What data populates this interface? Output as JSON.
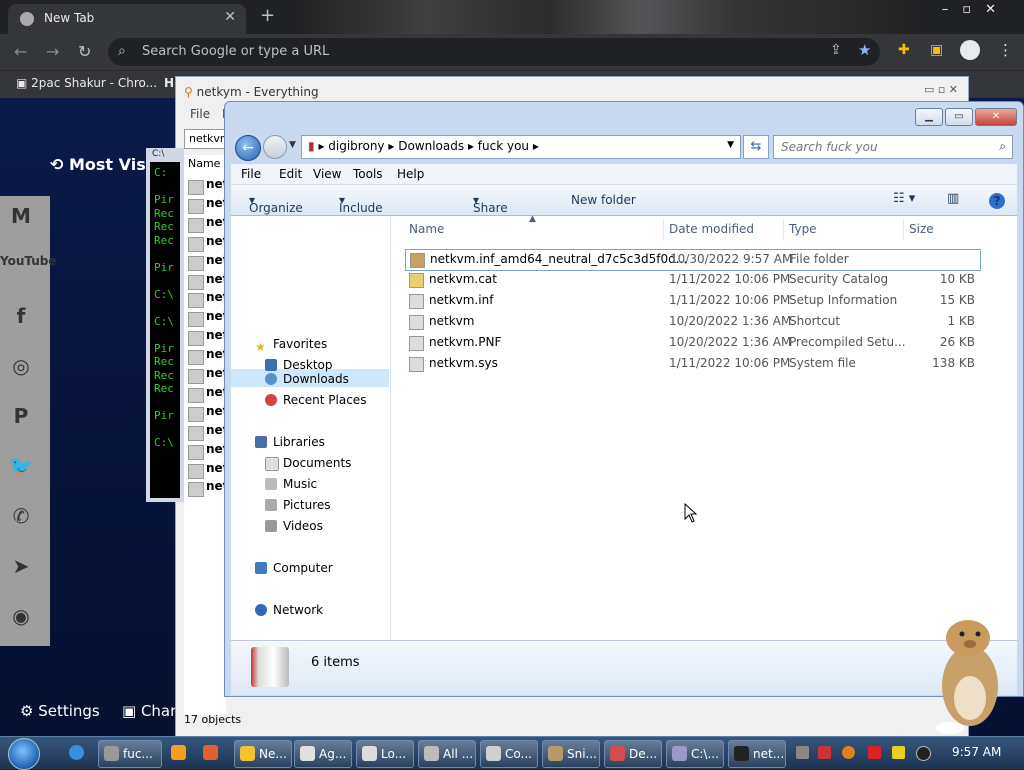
{
  "chrome": {
    "tab_title": "New Tab",
    "tab_close": "✕",
    "new_tab": "+",
    "omnibox_placeholder": "Search Google or type a URL",
    "bookmark_label": "2pac Shakur - Chro...",
    "bookmark_h": "H",
    "most_visited": "Most Visit",
    "settings": "Settings",
    "customize_chrome": "Char"
  },
  "social_icons": [
    "gmail-icon",
    "youtube-icon",
    "facebook-icon",
    "instagram-icon",
    "pinterest-icon",
    "twitter-icon",
    "whatsapp-icon",
    "telegram-icon",
    "reddit-icon"
  ],
  "social_glyphs": [
    "M",
    "YouTube",
    "f",
    "◎",
    "P",
    "🐦",
    "✆",
    "➤",
    "◉"
  ],
  "everything": {
    "title": "netkym - Everything",
    "menu_file": "File",
    "menu_e": "E",
    "search_value": "netkvm",
    "col_name": "Name",
    "items": [
      "net",
      "net",
      "net",
      "net",
      "net",
      "net",
      "net",
      "net",
      "net",
      "net",
      "net",
      "net",
      "net",
      "net",
      "net",
      "net",
      "net"
    ],
    "status": "17 objects"
  },
  "cmd": {
    "lines": [
      "C:",
      "",
      "Pir",
      "Rec",
      "Rec",
      "Rec",
      "",
      "Pir",
      "",
      "C:\\",
      "",
      "C:\\",
      "",
      "Pir",
      "Rec",
      "Rec",
      "Rec",
      "",
      "Pir",
      "",
      "C:\\"
    ]
  },
  "explorer": {
    "breadcrumb": [
      "digibrony",
      "Downloads",
      "fuck you"
    ],
    "search_placeholder": "Search fuck you",
    "menus": [
      "File",
      "Edit",
      "View",
      "Tools",
      "Help"
    ],
    "commands": [
      "Organize",
      "Include in library",
      "Share with",
      "New folder"
    ],
    "nav": {
      "favorites": "Favorites",
      "desktop": "Desktop",
      "downloads": "Downloads",
      "recent": "Recent Places",
      "libraries": "Libraries",
      "documents": "Documents",
      "music": "Music",
      "pictures": "Pictures",
      "videos": "Videos",
      "computer": "Computer",
      "network": "Network"
    },
    "columns": {
      "name": "Name",
      "date": "Date modified",
      "type": "Type",
      "size": "Size"
    },
    "files": [
      {
        "name": "netkvm.inf_amd64_neutral_d7c5c3d5f0d...",
        "date": "10/30/2022 9:57 AM",
        "type": "File folder",
        "size": ""
      },
      {
        "name": "netkvm.cat",
        "date": "1/11/2022 10:06 PM",
        "type": "Security Catalog",
        "size": "10 KB"
      },
      {
        "name": "netkvm.inf",
        "date": "1/11/2022 10:06 PM",
        "type": "Setup Information",
        "size": "15 KB"
      },
      {
        "name": "netkvm",
        "date": "10/20/2022 1:36 AM",
        "type": "Shortcut",
        "size": "1 KB"
      },
      {
        "name": "netkvm.PNF",
        "date": "10/20/2022 1:36 AM",
        "type": "Precompiled Setu...",
        "size": "26 KB"
      },
      {
        "name": "netkvm.sys",
        "date": "1/11/2022 10:06 PM",
        "type": "System file",
        "size": "138 KB"
      }
    ],
    "item_count": "6 items"
  },
  "taskbar": {
    "buttons": [
      "fuc...",
      "Ne...",
      "Ag...",
      "Lo...",
      "All ...",
      "Co...",
      "Sni...",
      "De...",
      "C:\\...",
      "net..."
    ],
    "clock": "9:57 AM"
  },
  "colors": {
    "accent": "#2860b0",
    "chrome_dark": "#202124",
    "taskbar": "#1c3352",
    "selection": "#cce8ff"
  }
}
